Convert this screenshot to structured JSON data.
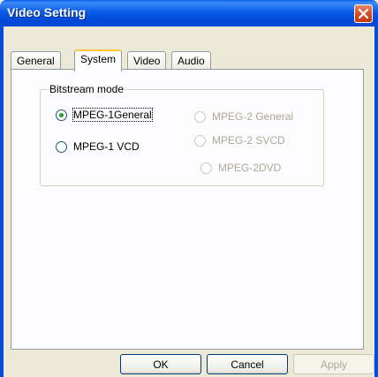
{
  "window": {
    "title": "Video Setting"
  },
  "tabs": [
    {
      "label": "General"
    },
    {
      "label": "System"
    },
    {
      "label": "Video"
    },
    {
      "label": "Audio"
    }
  ],
  "group": {
    "title": "Bitstream mode",
    "options": [
      {
        "label": "MPEG-1General",
        "selected": true,
        "enabled": true
      },
      {
        "label": "MPEG-1 VCD",
        "selected": false,
        "enabled": true
      },
      {
        "label": "MPEG-2 General",
        "selected": false,
        "enabled": false
      },
      {
        "label": "MPEG-2 SVCD",
        "selected": false,
        "enabled": false
      },
      {
        "label": "MPEG-2DVD",
        "selected": false,
        "enabled": false
      }
    ]
  },
  "buttons": {
    "ok": "OK",
    "cancel": "Cancel",
    "apply": "Apply"
  },
  "icons": {
    "close": "close-icon",
    "radio": "radio-icon"
  }
}
